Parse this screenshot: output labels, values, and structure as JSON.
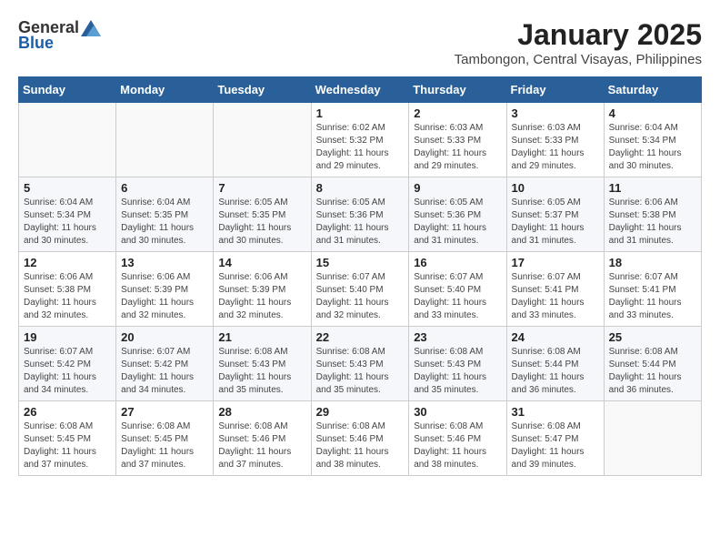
{
  "header": {
    "logo_general": "General",
    "logo_blue": "Blue",
    "month_title": "January 2025",
    "location": "Tambongon, Central Visayas, Philippines"
  },
  "weekdays": [
    "Sunday",
    "Monday",
    "Tuesday",
    "Wednesday",
    "Thursday",
    "Friday",
    "Saturday"
  ],
  "weeks": [
    [
      {
        "day": "",
        "sunrise": "",
        "sunset": "",
        "daylight": ""
      },
      {
        "day": "",
        "sunrise": "",
        "sunset": "",
        "daylight": ""
      },
      {
        "day": "",
        "sunrise": "",
        "sunset": "",
        "daylight": ""
      },
      {
        "day": "1",
        "sunrise": "Sunrise: 6:02 AM",
        "sunset": "Sunset: 5:32 PM",
        "daylight": "Daylight: 11 hours and 29 minutes."
      },
      {
        "day": "2",
        "sunrise": "Sunrise: 6:03 AM",
        "sunset": "Sunset: 5:33 PM",
        "daylight": "Daylight: 11 hours and 29 minutes."
      },
      {
        "day": "3",
        "sunrise": "Sunrise: 6:03 AM",
        "sunset": "Sunset: 5:33 PM",
        "daylight": "Daylight: 11 hours and 29 minutes."
      },
      {
        "day": "4",
        "sunrise": "Sunrise: 6:04 AM",
        "sunset": "Sunset: 5:34 PM",
        "daylight": "Daylight: 11 hours and 30 minutes."
      }
    ],
    [
      {
        "day": "5",
        "sunrise": "Sunrise: 6:04 AM",
        "sunset": "Sunset: 5:34 PM",
        "daylight": "Daylight: 11 hours and 30 minutes."
      },
      {
        "day": "6",
        "sunrise": "Sunrise: 6:04 AM",
        "sunset": "Sunset: 5:35 PM",
        "daylight": "Daylight: 11 hours and 30 minutes."
      },
      {
        "day": "7",
        "sunrise": "Sunrise: 6:05 AM",
        "sunset": "Sunset: 5:35 PM",
        "daylight": "Daylight: 11 hours and 30 minutes."
      },
      {
        "day": "8",
        "sunrise": "Sunrise: 6:05 AM",
        "sunset": "Sunset: 5:36 PM",
        "daylight": "Daylight: 11 hours and 31 minutes."
      },
      {
        "day": "9",
        "sunrise": "Sunrise: 6:05 AM",
        "sunset": "Sunset: 5:36 PM",
        "daylight": "Daylight: 11 hours and 31 minutes."
      },
      {
        "day": "10",
        "sunrise": "Sunrise: 6:05 AM",
        "sunset": "Sunset: 5:37 PM",
        "daylight": "Daylight: 11 hours and 31 minutes."
      },
      {
        "day": "11",
        "sunrise": "Sunrise: 6:06 AM",
        "sunset": "Sunset: 5:38 PM",
        "daylight": "Daylight: 11 hours and 31 minutes."
      }
    ],
    [
      {
        "day": "12",
        "sunrise": "Sunrise: 6:06 AM",
        "sunset": "Sunset: 5:38 PM",
        "daylight": "Daylight: 11 hours and 32 minutes."
      },
      {
        "day": "13",
        "sunrise": "Sunrise: 6:06 AM",
        "sunset": "Sunset: 5:39 PM",
        "daylight": "Daylight: 11 hours and 32 minutes."
      },
      {
        "day": "14",
        "sunrise": "Sunrise: 6:06 AM",
        "sunset": "Sunset: 5:39 PM",
        "daylight": "Daylight: 11 hours and 32 minutes."
      },
      {
        "day": "15",
        "sunrise": "Sunrise: 6:07 AM",
        "sunset": "Sunset: 5:40 PM",
        "daylight": "Daylight: 11 hours and 32 minutes."
      },
      {
        "day": "16",
        "sunrise": "Sunrise: 6:07 AM",
        "sunset": "Sunset: 5:40 PM",
        "daylight": "Daylight: 11 hours and 33 minutes."
      },
      {
        "day": "17",
        "sunrise": "Sunrise: 6:07 AM",
        "sunset": "Sunset: 5:41 PM",
        "daylight": "Daylight: 11 hours and 33 minutes."
      },
      {
        "day": "18",
        "sunrise": "Sunrise: 6:07 AM",
        "sunset": "Sunset: 5:41 PM",
        "daylight": "Daylight: 11 hours and 33 minutes."
      }
    ],
    [
      {
        "day": "19",
        "sunrise": "Sunrise: 6:07 AM",
        "sunset": "Sunset: 5:42 PM",
        "daylight": "Daylight: 11 hours and 34 minutes."
      },
      {
        "day": "20",
        "sunrise": "Sunrise: 6:07 AM",
        "sunset": "Sunset: 5:42 PM",
        "daylight": "Daylight: 11 hours and 34 minutes."
      },
      {
        "day": "21",
        "sunrise": "Sunrise: 6:08 AM",
        "sunset": "Sunset: 5:43 PM",
        "daylight": "Daylight: 11 hours and 35 minutes."
      },
      {
        "day": "22",
        "sunrise": "Sunrise: 6:08 AM",
        "sunset": "Sunset: 5:43 PM",
        "daylight": "Daylight: 11 hours and 35 minutes."
      },
      {
        "day": "23",
        "sunrise": "Sunrise: 6:08 AM",
        "sunset": "Sunset: 5:43 PM",
        "daylight": "Daylight: 11 hours and 35 minutes."
      },
      {
        "day": "24",
        "sunrise": "Sunrise: 6:08 AM",
        "sunset": "Sunset: 5:44 PM",
        "daylight": "Daylight: 11 hours and 36 minutes."
      },
      {
        "day": "25",
        "sunrise": "Sunrise: 6:08 AM",
        "sunset": "Sunset: 5:44 PM",
        "daylight": "Daylight: 11 hours and 36 minutes."
      }
    ],
    [
      {
        "day": "26",
        "sunrise": "Sunrise: 6:08 AM",
        "sunset": "Sunset: 5:45 PM",
        "daylight": "Daylight: 11 hours and 37 minutes."
      },
      {
        "day": "27",
        "sunrise": "Sunrise: 6:08 AM",
        "sunset": "Sunset: 5:45 PM",
        "daylight": "Daylight: 11 hours and 37 minutes."
      },
      {
        "day": "28",
        "sunrise": "Sunrise: 6:08 AM",
        "sunset": "Sunset: 5:46 PM",
        "daylight": "Daylight: 11 hours and 37 minutes."
      },
      {
        "day": "29",
        "sunrise": "Sunrise: 6:08 AM",
        "sunset": "Sunset: 5:46 PM",
        "daylight": "Daylight: 11 hours and 38 minutes."
      },
      {
        "day": "30",
        "sunrise": "Sunrise: 6:08 AM",
        "sunset": "Sunset: 5:46 PM",
        "daylight": "Daylight: 11 hours and 38 minutes."
      },
      {
        "day": "31",
        "sunrise": "Sunrise: 6:08 AM",
        "sunset": "Sunset: 5:47 PM",
        "daylight": "Daylight: 11 hours and 39 minutes."
      },
      {
        "day": "",
        "sunrise": "",
        "sunset": "",
        "daylight": ""
      }
    ]
  ]
}
